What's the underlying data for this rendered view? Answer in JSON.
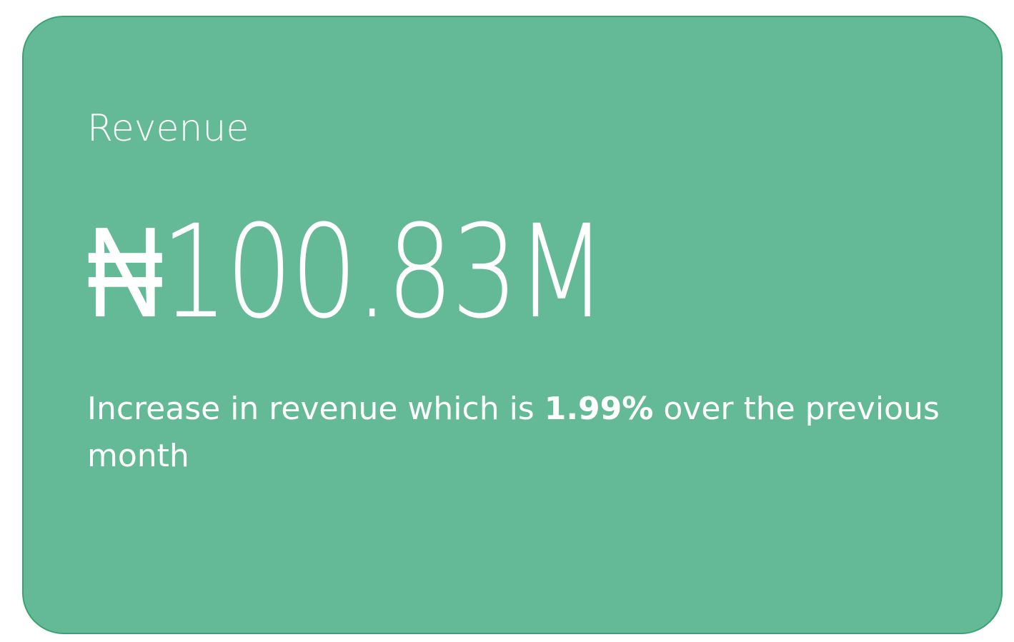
{
  "card": {
    "title": "Revenue",
    "value": "₦100.83M",
    "description": {
      "prefix": "Increase in revenue which is ",
      "highlight": "1.99%",
      "suffix": " over the previous month"
    }
  },
  "colors": {
    "card_background": "#64ba96",
    "card_border": "#3aa272",
    "text": "#ffffff",
    "page_background": "#ffffff"
  }
}
